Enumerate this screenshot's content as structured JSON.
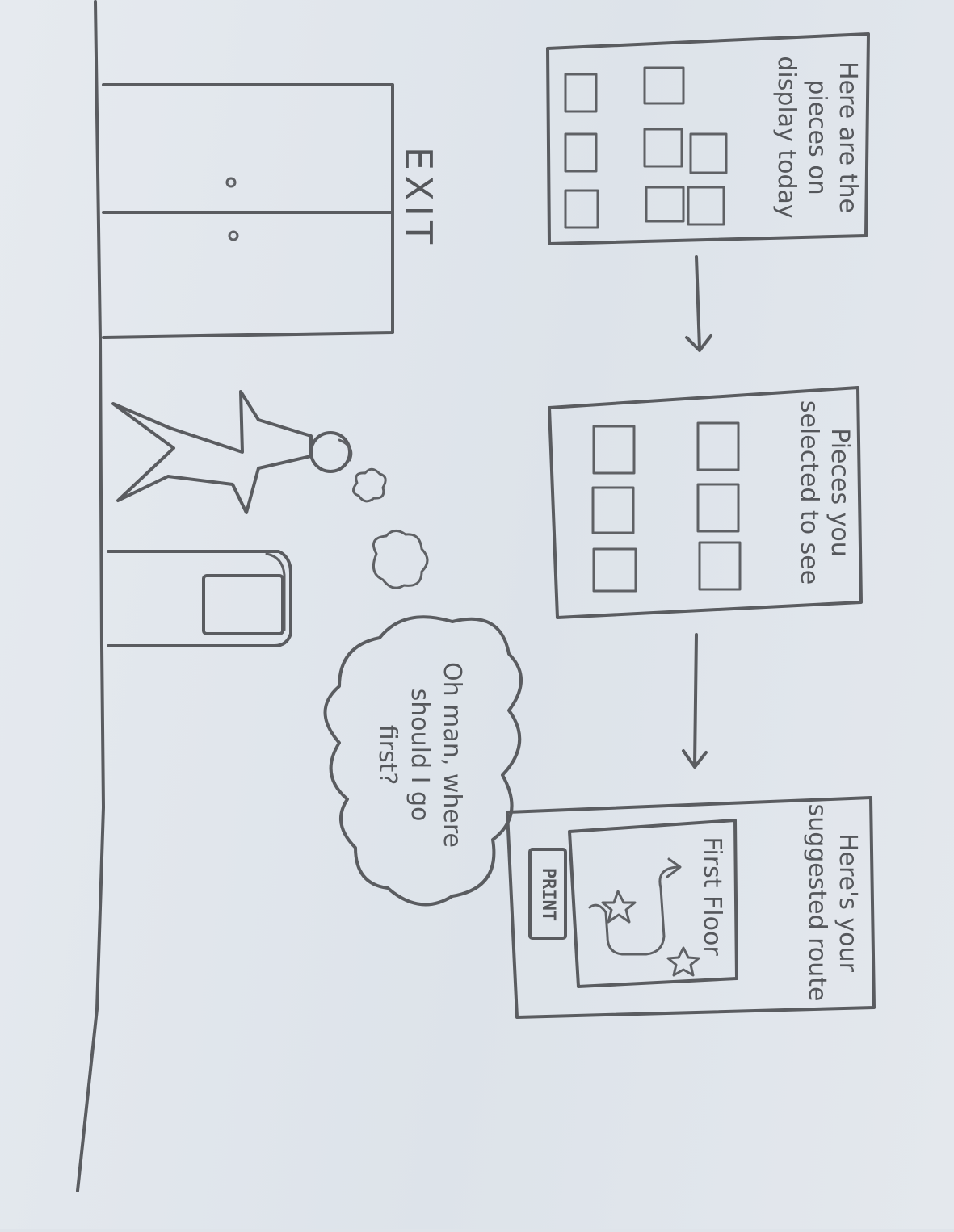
{
  "panels": {
    "display": {
      "title_lines": [
        "Here are the",
        "pieces on",
        "display today"
      ]
    },
    "selected": {
      "title_lines": [
        "Pieces you",
        "selected to see"
      ]
    },
    "route": {
      "title_lines": [
        "Here's your",
        "suggested route"
      ],
      "map_label": "First Floor",
      "print_label": "PRINT"
    }
  },
  "room": {
    "exit_sign": "EXIT"
  },
  "thought": {
    "lines": [
      "Oh man, where",
      "should I go",
      "first?"
    ]
  }
}
